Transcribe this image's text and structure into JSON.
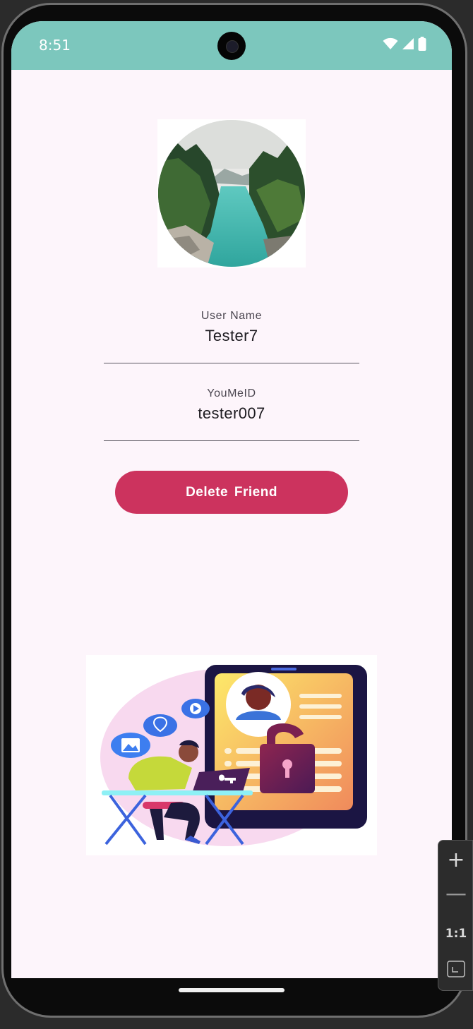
{
  "status_bar": {
    "time": "8:51",
    "background": "#7cc7bd",
    "icons": [
      "wifi-icon",
      "signal-icon",
      "battery-icon"
    ]
  },
  "profile": {
    "avatar_icon": "landscape-river-avatar",
    "user_name_label": "User Name",
    "user_name_value": "Tester7",
    "youme_id_label": "YouMeID",
    "youme_id_value": "tester007"
  },
  "actions": {
    "delete_label": "Delete  Friend",
    "delete_color": "#cc335e"
  },
  "illustration": {
    "icon": "privacy-security-illustration"
  },
  "zoom_controls": {
    "zoom_in": "+",
    "zoom_out": "—",
    "reset": "1:1"
  }
}
